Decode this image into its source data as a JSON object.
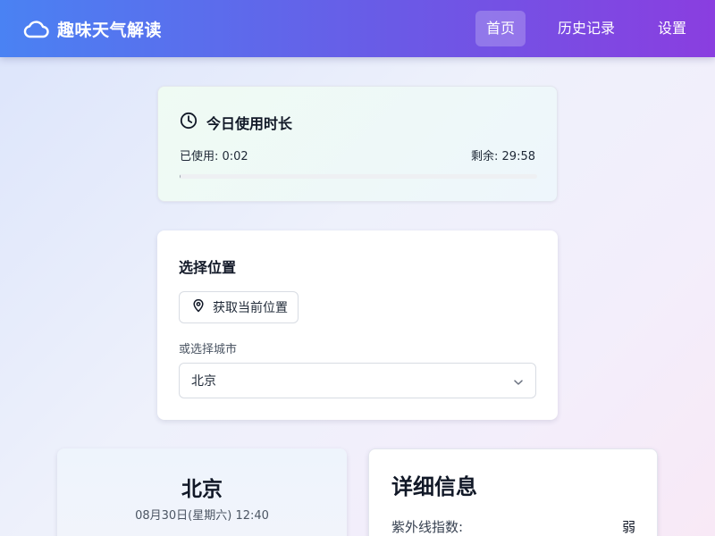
{
  "app": {
    "title": "趣味天气解读"
  },
  "nav": {
    "items": [
      {
        "label": "首页",
        "active": true
      },
      {
        "label": "历史记录",
        "active": false
      },
      {
        "label": "设置",
        "active": false
      }
    ]
  },
  "usage": {
    "title": "今日使用时长",
    "used": "已使用: 0:02",
    "remaining": "剩余: 29:58",
    "progress_fraction": 0.0011
  },
  "location": {
    "title": "选择位置",
    "get_location_button": "获取当前位置",
    "or_label": "或选择城市",
    "selected_city": "北京"
  },
  "weather": {
    "city": "北京",
    "datetime": "08月30日(星期六) 12:40"
  },
  "details": {
    "title": "详细信息",
    "uv_label": "紫外线指数:",
    "uv_value": "弱"
  },
  "colors": {
    "nav_gradient_start": "#4a82f3",
    "nav_gradient_end": "#8a3ee0"
  },
  "icons": {
    "brand": "cloud-icon",
    "usage": "clock-icon",
    "location_button": "map-pin-icon",
    "select": "chevron-down-icon"
  }
}
